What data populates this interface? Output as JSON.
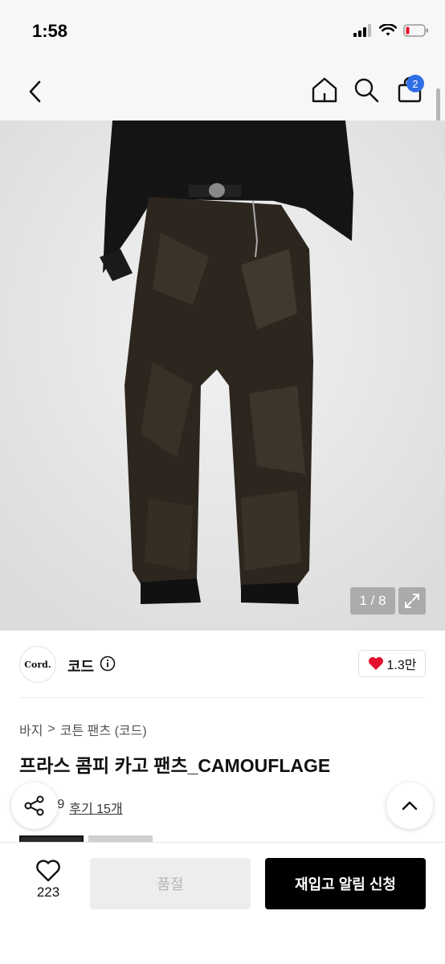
{
  "status": {
    "time": "1:58"
  },
  "nav": {
    "cart_count": "2",
    "icons": [
      "back-icon",
      "home-icon",
      "search-icon",
      "cart-icon"
    ]
  },
  "image": {
    "counter": "1 / 8"
  },
  "brand": {
    "logo_text": "Cord.",
    "name": "코드",
    "like_count": "1.3만"
  },
  "breadcrumb": {
    "category": "바지",
    "separator": ">",
    "subcategory": "코튼 팬츠 (코드)"
  },
  "product": {
    "title": "프라스 콤피 카고 팬츠_CAMOUFLAGE"
  },
  "review": {
    "score": "4.9",
    "link": "후기 15개"
  },
  "bottom": {
    "wish_count": "223",
    "soldout_label": "품절",
    "restock_label": "재입고 알림 신청"
  },
  "colors": {
    "accent": "#2f6fe6",
    "heart": "#e5102b",
    "primary_button": "#000000"
  }
}
